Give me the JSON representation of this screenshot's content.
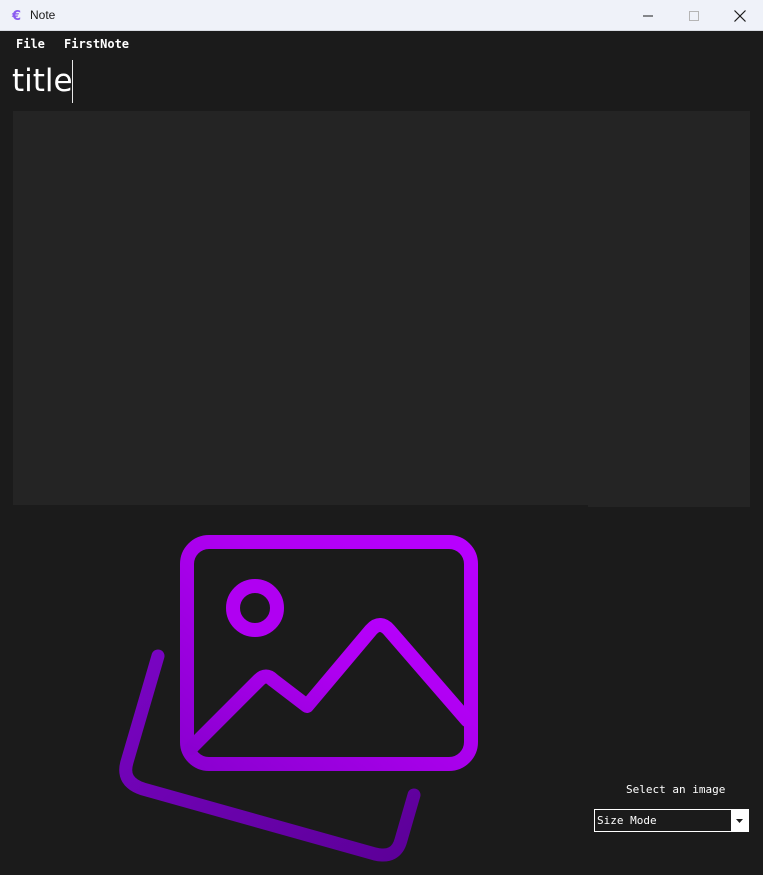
{
  "window": {
    "title": "Note",
    "app_icon": "euro-sign-icon",
    "controls": [
      "minimize-icon",
      "maximize-icon",
      "close-icon"
    ]
  },
  "menu": {
    "items": [
      {
        "label": "File"
      },
      {
        "label": "FirstNote"
      }
    ]
  },
  "note": {
    "title_value": "title",
    "body_value": ""
  },
  "image": {
    "placeholder_icon": "images-icon",
    "select_label": "Select an image",
    "size_mode": {
      "selected": "Size Mode",
      "dropdown_icon": "caret-down-icon"
    }
  },
  "colors": {
    "background": "#1b1b1b",
    "editor_bg": "#242424",
    "titlebar_bg": "#eff2f9",
    "accent_purple": "#b000f2",
    "accent_dark_purple": "#6a00a8",
    "text": "#ffffff"
  }
}
